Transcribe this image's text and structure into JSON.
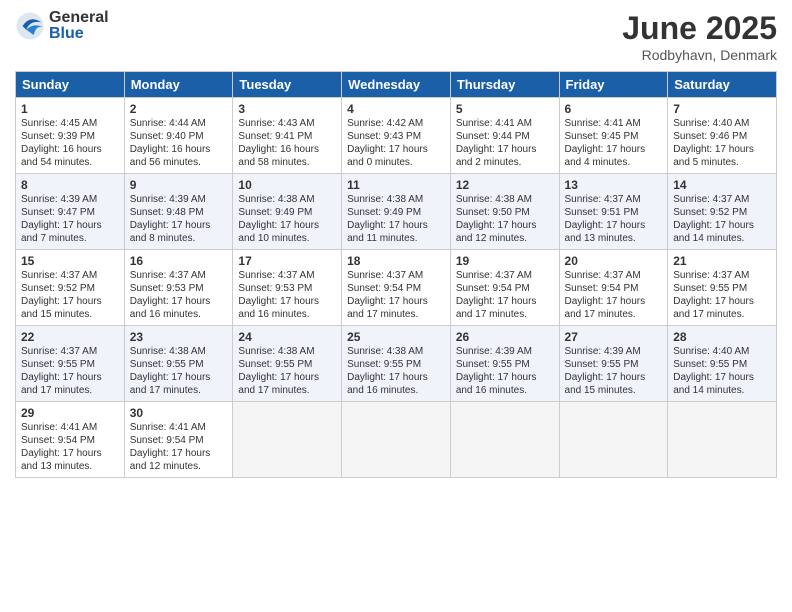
{
  "logo": {
    "general": "General",
    "blue": "Blue"
  },
  "title": "June 2025",
  "location": "Rodbyhavn, Denmark",
  "days_header": [
    "Sunday",
    "Monday",
    "Tuesday",
    "Wednesday",
    "Thursday",
    "Friday",
    "Saturday"
  ],
  "weeks": [
    [
      {
        "day": "1",
        "lines": [
          "Sunrise: 4:45 AM",
          "Sunset: 9:39 PM",
          "Daylight: 16 hours",
          "and 54 minutes."
        ]
      },
      {
        "day": "2",
        "lines": [
          "Sunrise: 4:44 AM",
          "Sunset: 9:40 PM",
          "Daylight: 16 hours",
          "and 56 minutes."
        ]
      },
      {
        "day": "3",
        "lines": [
          "Sunrise: 4:43 AM",
          "Sunset: 9:41 PM",
          "Daylight: 16 hours",
          "and 58 minutes."
        ]
      },
      {
        "day": "4",
        "lines": [
          "Sunrise: 4:42 AM",
          "Sunset: 9:43 PM",
          "Daylight: 17 hours",
          "and 0 minutes."
        ]
      },
      {
        "day": "5",
        "lines": [
          "Sunrise: 4:41 AM",
          "Sunset: 9:44 PM",
          "Daylight: 17 hours",
          "and 2 minutes."
        ]
      },
      {
        "day": "6",
        "lines": [
          "Sunrise: 4:41 AM",
          "Sunset: 9:45 PM",
          "Daylight: 17 hours",
          "and 4 minutes."
        ]
      },
      {
        "day": "7",
        "lines": [
          "Sunrise: 4:40 AM",
          "Sunset: 9:46 PM",
          "Daylight: 17 hours",
          "and 5 minutes."
        ]
      }
    ],
    [
      {
        "day": "8",
        "lines": [
          "Sunrise: 4:39 AM",
          "Sunset: 9:47 PM",
          "Daylight: 17 hours",
          "and 7 minutes."
        ]
      },
      {
        "day": "9",
        "lines": [
          "Sunrise: 4:39 AM",
          "Sunset: 9:48 PM",
          "Daylight: 17 hours",
          "and 8 minutes."
        ]
      },
      {
        "day": "10",
        "lines": [
          "Sunrise: 4:38 AM",
          "Sunset: 9:49 PM",
          "Daylight: 17 hours",
          "and 10 minutes."
        ]
      },
      {
        "day": "11",
        "lines": [
          "Sunrise: 4:38 AM",
          "Sunset: 9:49 PM",
          "Daylight: 17 hours",
          "and 11 minutes."
        ]
      },
      {
        "day": "12",
        "lines": [
          "Sunrise: 4:38 AM",
          "Sunset: 9:50 PM",
          "Daylight: 17 hours",
          "and 12 minutes."
        ]
      },
      {
        "day": "13",
        "lines": [
          "Sunrise: 4:37 AM",
          "Sunset: 9:51 PM",
          "Daylight: 17 hours",
          "and 13 minutes."
        ]
      },
      {
        "day": "14",
        "lines": [
          "Sunrise: 4:37 AM",
          "Sunset: 9:52 PM",
          "Daylight: 17 hours",
          "and 14 minutes."
        ]
      }
    ],
    [
      {
        "day": "15",
        "lines": [
          "Sunrise: 4:37 AM",
          "Sunset: 9:52 PM",
          "Daylight: 17 hours",
          "and 15 minutes."
        ]
      },
      {
        "day": "16",
        "lines": [
          "Sunrise: 4:37 AM",
          "Sunset: 9:53 PM",
          "Daylight: 17 hours",
          "and 16 minutes."
        ]
      },
      {
        "day": "17",
        "lines": [
          "Sunrise: 4:37 AM",
          "Sunset: 9:53 PM",
          "Daylight: 17 hours",
          "and 16 minutes."
        ]
      },
      {
        "day": "18",
        "lines": [
          "Sunrise: 4:37 AM",
          "Sunset: 9:54 PM",
          "Daylight: 17 hours",
          "and 17 minutes."
        ]
      },
      {
        "day": "19",
        "lines": [
          "Sunrise: 4:37 AM",
          "Sunset: 9:54 PM",
          "Daylight: 17 hours",
          "and 17 minutes."
        ]
      },
      {
        "day": "20",
        "lines": [
          "Sunrise: 4:37 AM",
          "Sunset: 9:54 PM",
          "Daylight: 17 hours",
          "and 17 minutes."
        ]
      },
      {
        "day": "21",
        "lines": [
          "Sunrise: 4:37 AM",
          "Sunset: 9:55 PM",
          "Daylight: 17 hours",
          "and 17 minutes."
        ]
      }
    ],
    [
      {
        "day": "22",
        "lines": [
          "Sunrise: 4:37 AM",
          "Sunset: 9:55 PM",
          "Daylight: 17 hours",
          "and 17 minutes."
        ]
      },
      {
        "day": "23",
        "lines": [
          "Sunrise: 4:38 AM",
          "Sunset: 9:55 PM",
          "Daylight: 17 hours",
          "and 17 minutes."
        ]
      },
      {
        "day": "24",
        "lines": [
          "Sunrise: 4:38 AM",
          "Sunset: 9:55 PM",
          "Daylight: 17 hours",
          "and 17 minutes."
        ]
      },
      {
        "day": "25",
        "lines": [
          "Sunrise: 4:38 AM",
          "Sunset: 9:55 PM",
          "Daylight: 17 hours",
          "and 16 minutes."
        ]
      },
      {
        "day": "26",
        "lines": [
          "Sunrise: 4:39 AM",
          "Sunset: 9:55 PM",
          "Daylight: 17 hours",
          "and 16 minutes."
        ]
      },
      {
        "day": "27",
        "lines": [
          "Sunrise: 4:39 AM",
          "Sunset: 9:55 PM",
          "Daylight: 17 hours",
          "and 15 minutes."
        ]
      },
      {
        "day": "28",
        "lines": [
          "Sunrise: 4:40 AM",
          "Sunset: 9:55 PM",
          "Daylight: 17 hours",
          "and 14 minutes."
        ]
      }
    ],
    [
      {
        "day": "29",
        "lines": [
          "Sunrise: 4:41 AM",
          "Sunset: 9:54 PM",
          "Daylight: 17 hours",
          "and 13 minutes."
        ]
      },
      {
        "day": "30",
        "lines": [
          "Sunrise: 4:41 AM",
          "Sunset: 9:54 PM",
          "Daylight: 17 hours",
          "and 12 minutes."
        ]
      },
      null,
      null,
      null,
      null,
      null
    ]
  ]
}
